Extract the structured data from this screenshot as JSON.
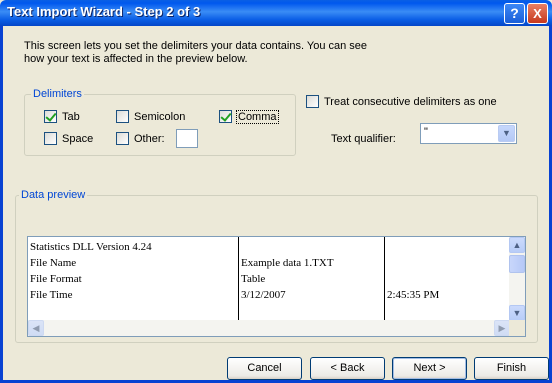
{
  "window": {
    "title": "Text Import Wizard - Step 2 of 3",
    "help_glyph": "?",
    "close_glyph": "X"
  },
  "intro": "This screen lets you set the delimiters your data contains.  You can see\nhow your text is affected in the preview below.",
  "delimiters": {
    "label": "Delimiters",
    "tab": {
      "label": "Tab",
      "checked": true
    },
    "semicolon": {
      "label": "Semicolon",
      "checked": false
    },
    "comma": {
      "label": "Comma",
      "checked": true
    },
    "space": {
      "label": "Space",
      "checked": false
    },
    "other": {
      "label": "Other:",
      "checked": false,
      "value": ""
    }
  },
  "consecutive": {
    "label": "Treat consecutive delimiters as one",
    "checked": false
  },
  "qualifier": {
    "label": "Text qualifier:",
    "value": "\""
  },
  "preview": {
    "label": "Data preview",
    "rows": [
      [
        "Statistics DLL Version 4.24",
        "",
        ""
      ],
      [
        "File Name",
        "Example data 1.TXT",
        ""
      ],
      [
        "File Format",
        "Table",
        ""
      ],
      [
        "File Time",
        "3/12/2007",
        "2:45:35 PM"
      ]
    ]
  },
  "buttons": {
    "cancel": "Cancel",
    "back": "< Back",
    "next": "Next >",
    "finish": "Finish"
  },
  "colors": {
    "titlebar": "#0058ee",
    "group_label": "#0046d5",
    "dialog_bg": "#ece9d8"
  }
}
